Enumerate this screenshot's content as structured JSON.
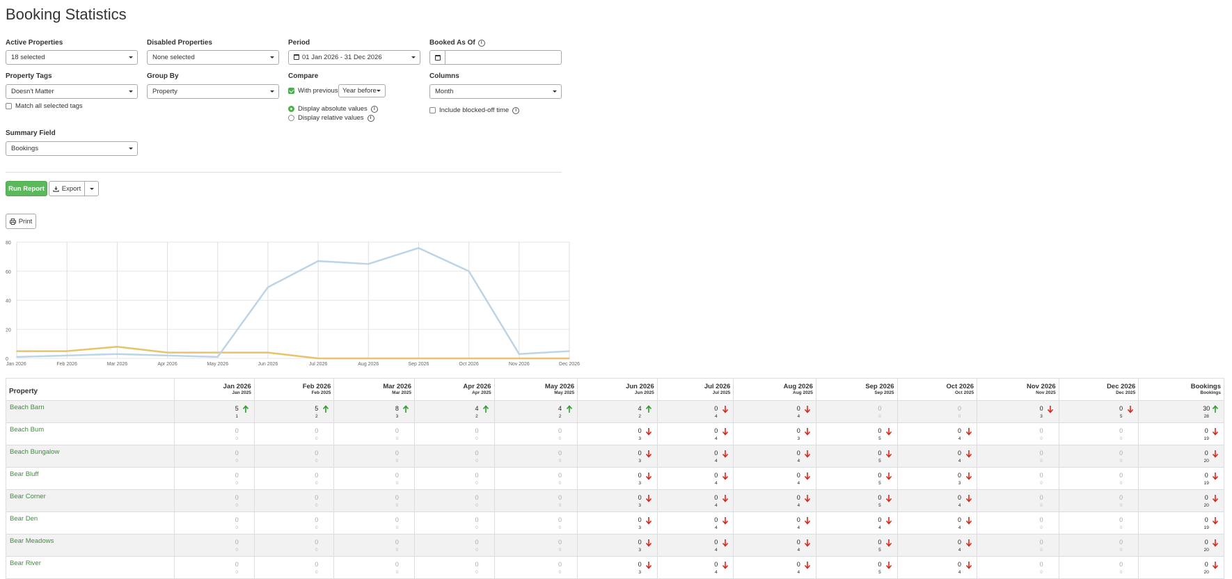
{
  "page_title": "Booking Statistics",
  "filters": {
    "active_properties": {
      "label": "Active Properties",
      "value": "18 selected"
    },
    "disabled_properties": {
      "label": "Disabled Properties",
      "value": "None selected"
    },
    "period": {
      "label": "Period",
      "value": "01 Jan 2026 - 31 Dec 2026"
    },
    "booked_as_of": {
      "label": "Booked As Of",
      "value": ""
    },
    "property_tags": {
      "label": "Property Tags",
      "value": "Doesn't Matter",
      "match_all_label": "Match all selected tags",
      "match_all_checked": false
    },
    "group_by": {
      "label": "Group By",
      "value": "Property"
    },
    "compare": {
      "label": "Compare",
      "with_previous_label": "With previous",
      "with_previous_checked": true,
      "previous_value": "Year before",
      "absolute_label": "Display absolute values",
      "relative_label": "Display relative values",
      "display_mode": "absolute"
    },
    "columns": {
      "label": "Columns",
      "value": "Month",
      "blocked_label": "Include blocked-off time",
      "blocked_checked": false
    },
    "summary_field": {
      "label": "Summary Field",
      "value": "Bookings"
    }
  },
  "actions": {
    "run_report": "Run Report",
    "export": "Export",
    "print": "Print"
  },
  "chart_data": {
    "type": "line",
    "x": [
      "Jan 2026",
      "Feb 2026",
      "Mar 2026",
      "Apr 2026",
      "May 2026",
      "Jun 2026",
      "Jul 2026",
      "Aug 2026",
      "Sep 2026",
      "Oct 2026",
      "Nov 2026",
      "Dec 2026"
    ],
    "ylim": [
      0,
      80
    ],
    "yticks": [
      0,
      20,
      40,
      60,
      80
    ],
    "grid": true,
    "series": [
      {
        "values": [
          5,
          5,
          8,
          4,
          4,
          4,
          0,
          0,
          0,
          0,
          0,
          0
        ],
        "color": "#e8c36a"
      },
      {
        "values": [
          1,
          2,
          3,
          2,
          1,
          49,
          67,
          65,
          76,
          60,
          3,
          5
        ],
        "color": "#bcd4e6"
      }
    ]
  },
  "table": {
    "property_header": "Property",
    "columns": [
      {
        "label": "Jan 2026",
        "sub": "Jan 2025"
      },
      {
        "label": "Feb 2026",
        "sub": "Feb 2025"
      },
      {
        "label": "Mar 2026",
        "sub": "Mar 2025"
      },
      {
        "label": "Apr 2026",
        "sub": "Apr 2025"
      },
      {
        "label": "May 2026",
        "sub": "May 2025"
      },
      {
        "label": "Jun 2026",
        "sub": "Jun 2025"
      },
      {
        "label": "Jul 2026",
        "sub": "Jul 2025"
      },
      {
        "label": "Aug 2026",
        "sub": "Aug 2025"
      },
      {
        "label": "Sep 2026",
        "sub": "Sep 2025"
      },
      {
        "label": "Oct 2026",
        "sub": "Oct 2025"
      },
      {
        "label": "Nov 2026",
        "sub": "Nov 2025"
      },
      {
        "label": "Dec 2026",
        "sub": "Dec 2025"
      },
      {
        "label": "Bookings",
        "sub": "Bookings"
      }
    ],
    "rows": [
      {
        "name": "Beach Barn",
        "cells": [
          [
            "5",
            "1",
            "up"
          ],
          [
            "5",
            "2",
            "up"
          ],
          [
            "8",
            "3",
            "up"
          ],
          [
            "4",
            "2",
            "up"
          ],
          [
            "4",
            "2",
            "up"
          ],
          [
            "4",
            "2",
            "up"
          ],
          [
            "0",
            "4",
            "down"
          ],
          [
            "0",
            "4",
            "down"
          ],
          [
            "0",
            "0",
            ""
          ],
          [
            "0",
            "0",
            ""
          ],
          [
            "0",
            "3",
            "down"
          ],
          [
            "0",
            "5",
            "down"
          ],
          [
            "30",
            "28",
            "up"
          ]
        ]
      },
      {
        "name": "Beach Bum",
        "cells": [
          [
            "0",
            "0",
            ""
          ],
          [
            "0",
            "0",
            ""
          ],
          [
            "0",
            "0",
            ""
          ],
          [
            "0",
            "0",
            ""
          ],
          [
            "0",
            "0",
            ""
          ],
          [
            "0",
            "3",
            "down"
          ],
          [
            "0",
            "4",
            "down"
          ],
          [
            "0",
            "3",
            "down"
          ],
          [
            "0",
            "5",
            "down"
          ],
          [
            "0",
            "4",
            "down"
          ],
          [
            "0",
            "0",
            ""
          ],
          [
            "0",
            "0",
            ""
          ],
          [
            "0",
            "19",
            "down"
          ]
        ]
      },
      {
        "name": "Beach Bungalow",
        "cells": [
          [
            "0",
            "0",
            ""
          ],
          [
            "0",
            "0",
            ""
          ],
          [
            "0",
            "0",
            ""
          ],
          [
            "0",
            "0",
            ""
          ],
          [
            "0",
            "0",
            ""
          ],
          [
            "0",
            "3",
            "down"
          ],
          [
            "0",
            "4",
            "down"
          ],
          [
            "0",
            "4",
            "down"
          ],
          [
            "0",
            "5",
            "down"
          ],
          [
            "0",
            "4",
            "down"
          ],
          [
            "0",
            "0",
            ""
          ],
          [
            "0",
            "0",
            ""
          ],
          [
            "0",
            "20",
            "down"
          ]
        ]
      },
      {
        "name": "Bear Bluff",
        "cells": [
          [
            "0",
            "0",
            ""
          ],
          [
            "0",
            "0",
            ""
          ],
          [
            "0",
            "0",
            ""
          ],
          [
            "0",
            "0",
            ""
          ],
          [
            "0",
            "0",
            ""
          ],
          [
            "0",
            "3",
            "down"
          ],
          [
            "0",
            "4",
            "down"
          ],
          [
            "0",
            "4",
            "down"
          ],
          [
            "0",
            "5",
            "down"
          ],
          [
            "0",
            "3",
            "down"
          ],
          [
            "0",
            "0",
            ""
          ],
          [
            "0",
            "0",
            ""
          ],
          [
            "0",
            "19",
            "down"
          ]
        ]
      },
      {
        "name": "Bear Corner",
        "cells": [
          [
            "0",
            "0",
            ""
          ],
          [
            "0",
            "0",
            ""
          ],
          [
            "0",
            "0",
            ""
          ],
          [
            "0",
            "0",
            ""
          ],
          [
            "0",
            "0",
            ""
          ],
          [
            "0",
            "3",
            "down"
          ],
          [
            "0",
            "4",
            "down"
          ],
          [
            "0",
            "4",
            "down"
          ],
          [
            "0",
            "5",
            "down"
          ],
          [
            "0",
            "4",
            "down"
          ],
          [
            "0",
            "0",
            ""
          ],
          [
            "0",
            "0",
            ""
          ],
          [
            "0",
            "20",
            "down"
          ]
        ]
      },
      {
        "name": "Bear Den",
        "cells": [
          [
            "0",
            "0",
            ""
          ],
          [
            "0",
            "0",
            ""
          ],
          [
            "0",
            "0",
            ""
          ],
          [
            "0",
            "0",
            ""
          ],
          [
            "0",
            "0",
            ""
          ],
          [
            "0",
            "3",
            "down"
          ],
          [
            "0",
            "4",
            "down"
          ],
          [
            "0",
            "4",
            "down"
          ],
          [
            "0",
            "4",
            "down"
          ],
          [
            "0",
            "4",
            "down"
          ],
          [
            "0",
            "0",
            ""
          ],
          [
            "0",
            "0",
            ""
          ],
          [
            "0",
            "19",
            "down"
          ]
        ]
      },
      {
        "name": "Bear Meadows",
        "cells": [
          [
            "0",
            "0",
            ""
          ],
          [
            "0",
            "0",
            ""
          ],
          [
            "0",
            "0",
            ""
          ],
          [
            "0",
            "0",
            ""
          ],
          [
            "0",
            "0",
            ""
          ],
          [
            "0",
            "3",
            "down"
          ],
          [
            "0",
            "4",
            "down"
          ],
          [
            "0",
            "4",
            "down"
          ],
          [
            "0",
            "5",
            "down"
          ],
          [
            "0",
            "4",
            "down"
          ],
          [
            "0",
            "0",
            ""
          ],
          [
            "0",
            "0",
            ""
          ],
          [
            "0",
            "20",
            "down"
          ]
        ]
      },
      {
        "name": "Bear River",
        "cells": [
          [
            "0",
            "0",
            ""
          ],
          [
            "0",
            "0",
            ""
          ],
          [
            "0",
            "0",
            ""
          ],
          [
            "0",
            "0",
            ""
          ],
          [
            "0",
            "0",
            ""
          ],
          [
            "0",
            "3",
            "down"
          ],
          [
            "0",
            "4",
            "down"
          ],
          [
            "0",
            "4",
            "down"
          ],
          [
            "0",
            "5",
            "down"
          ],
          [
            "0",
            "4",
            "down"
          ],
          [
            "0",
            "0",
            ""
          ],
          [
            "0",
            "0",
            ""
          ],
          [
            "0",
            "20",
            "down"
          ]
        ]
      }
    ]
  }
}
